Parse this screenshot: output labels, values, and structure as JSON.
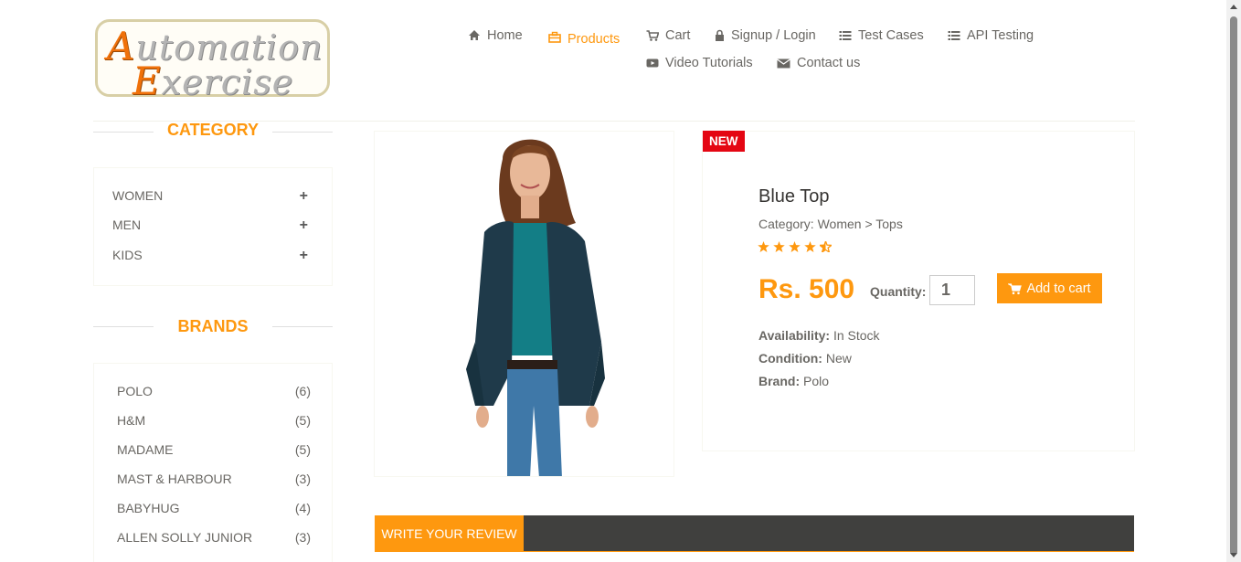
{
  "logo": {
    "line1_cap": "A",
    "line1_rest": "utomation",
    "line2_cap": "E",
    "line2_rest": "xercise"
  },
  "nav": {
    "home": "Home",
    "products": "Products",
    "cart": "Cart",
    "signup_login": "Signup / Login",
    "test_cases": "Test Cases",
    "api_testing": "API Testing",
    "video_tutorials": "Video Tutorials",
    "contact_us": "Contact us"
  },
  "sidebar": {
    "category_title": "CATEGORY",
    "categories": [
      {
        "label": "WOMEN",
        "toggle": "+"
      },
      {
        "label": "MEN",
        "toggle": "+"
      },
      {
        "label": "KIDS",
        "toggle": "+"
      }
    ],
    "brands_title": "BRANDS",
    "brands": [
      {
        "name": "POLO",
        "count": "(6)"
      },
      {
        "name": "H&M",
        "count": "(5)"
      },
      {
        "name": "MADAME",
        "count": "(5)"
      },
      {
        "name": "MAST & HARBOUR",
        "count": "(3)"
      },
      {
        "name": "BABYHUG",
        "count": "(4)"
      },
      {
        "name": "ALLEN SOLLY JUNIOR",
        "count": "(3)"
      }
    ]
  },
  "product": {
    "badge": "NEW",
    "name": "Blue Top",
    "category": "Category: Women > Tops",
    "rating": 4.5,
    "price": "Rs. 500",
    "quantity_label": "Quantity:",
    "quantity_value": "1",
    "add_to_cart": "Add to cart",
    "availability_label": "Availability:",
    "availability_value": " In Stock",
    "condition_label": "Condition:",
    "condition_value": " New",
    "brand_label": "Brand:",
    "brand_value": " Polo"
  },
  "review": {
    "tab_label": "WRITE YOUR REVIEW"
  },
  "colors": {
    "accent": "#FE980F",
    "badge": "#e40613",
    "dark_bar": "#40403E",
    "text": "#696763"
  }
}
